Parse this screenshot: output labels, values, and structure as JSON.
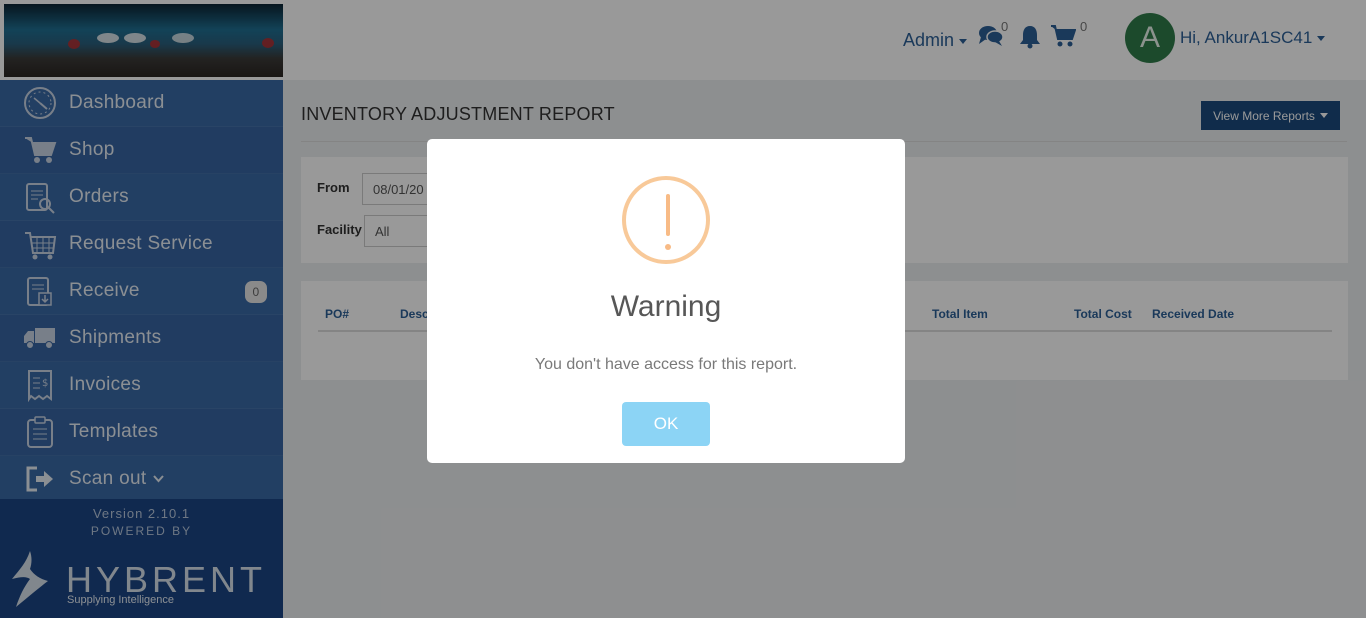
{
  "sidebar": {
    "items": [
      {
        "label": "Dashboard",
        "icon": "dashboard-icon"
      },
      {
        "label": "Shop",
        "icon": "cart-icon"
      },
      {
        "label": "Orders",
        "icon": "orders-icon"
      },
      {
        "label": "Request Service",
        "icon": "request-service-icon"
      },
      {
        "label": "Receive",
        "icon": "receive-icon",
        "badge": "0"
      },
      {
        "label": "Shipments",
        "icon": "truck-icon"
      },
      {
        "label": "Invoices",
        "icon": "invoice-icon"
      },
      {
        "label": "Templates",
        "icon": "templates-icon"
      },
      {
        "label": "Scan out",
        "icon": "scan-out-icon"
      }
    ],
    "version": "Version 2.10.1",
    "powered_by": "POWERED BY",
    "brand": "HYBRENT",
    "tagline": "Supplying Intelligence"
  },
  "topbar": {
    "admin_label": "Admin",
    "messages_count": "0",
    "cart_count": "0",
    "avatar_initial": "A",
    "greeting": "Hi, AnkurA1SC41"
  },
  "main": {
    "title": "INVENTORY ADJUSTMENT REPORT",
    "more_reports_label": "View More Reports",
    "filters": {
      "from_label": "From",
      "from_value": "08/01/20",
      "facility_label": "Facility",
      "facility_value": "All"
    },
    "table_headers": [
      "PO#",
      "Desc",
      "Total Item",
      "Total Cost",
      "Received Date"
    ]
  },
  "modal": {
    "title": "Warning",
    "message": "You don't have access for this report.",
    "ok_label": "OK"
  },
  "colors": {
    "sidebar": "#3765a2",
    "sidebar_footer": "#1b4584",
    "accent": "#2c5f96",
    "warning": "#f8bb86",
    "ok_button": "#8cd4f5"
  }
}
